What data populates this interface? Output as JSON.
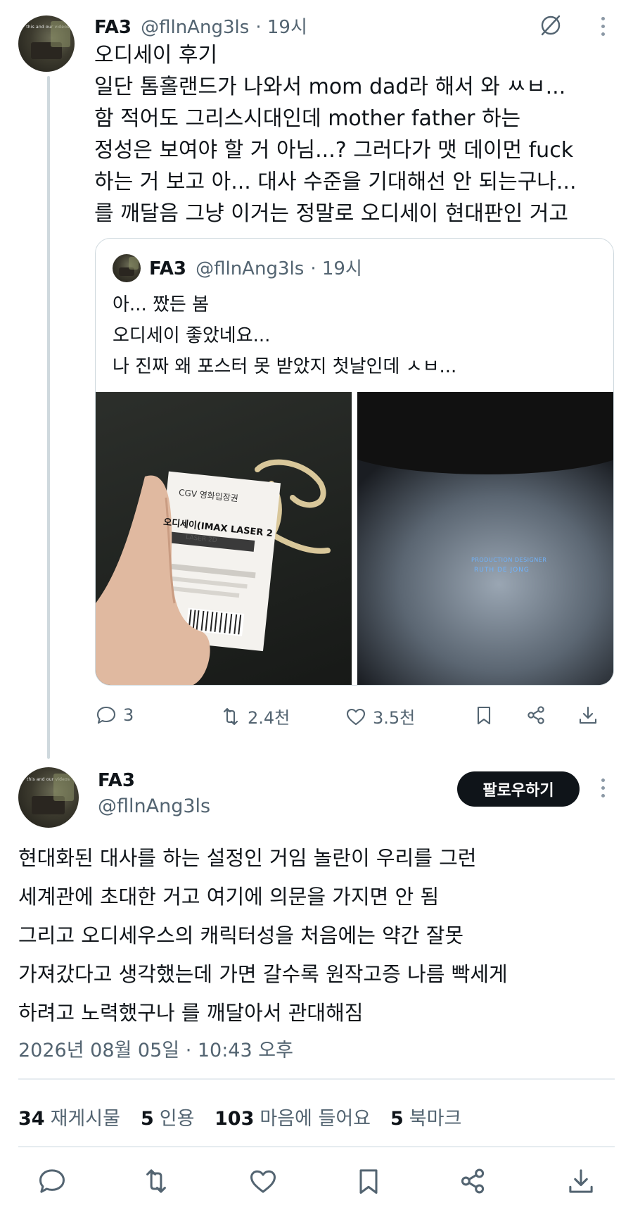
{
  "quoting_tweet": {
    "display_name": "FA3",
    "handle": "@fllnAng3ls",
    "time": "· 19시",
    "lines": [
      "오디세이 후기",
      "일단 톰홀랜드가 나와서 mom dad라 해서 와 ㅆㅂ...",
      "함 적어도 그리스시대인데 mother father 하는",
      "정성은 보여야 할 거 아님...? 그러다가 맷 데이먼 fuck",
      "하는 거 보고 아... 대사 수준을 기대해선 안 되는구나...",
      "를 깨달음 그냥 이거는 정말로 오디세이 현대판인 거고"
    ],
    "avatar_caption": "this and our videos",
    "actions": {
      "replies": "3",
      "retweets": "2.4천",
      "likes": "3.5천"
    }
  },
  "quoted_tweet": {
    "display_name": "FA3",
    "handle": "@fllnAng3ls",
    "time": "· 19시",
    "lines": [
      "아... 짰든 봄",
      "오디세이 좋았네요...",
      "나 진짜 왜 포스터 못 받았지 첫날인데 ㅅㅂ..."
    ],
    "ticket": {
      "header": "CGV 영화입장권",
      "title": "오디세이(IMAX LASER 2",
      "sub": "LASER 2D"
    },
    "credit": {
      "line1": "PRODUCTION DESIGNER",
      "line2": "RUTH DE JONG"
    }
  },
  "reply_tweet": {
    "display_name": "FA3",
    "handle": "@fllnAng3ls",
    "follow_label": "팔로우하기",
    "lines": [
      "현대화된 대사를 하는 설정인 거임 놀란이 우리를 그런",
      "세계관에 초대한 거고 여기에 의문을 가지면 안 됨",
      "그리고 오디세우스의 캐릭터성을 처음에는 약간 잘못",
      "가져갔다고 생각했는데 가면 갈수록 원작고증 나름 빡세게",
      "하려고 노력했구나 를 깨달아서 관대해짐"
    ],
    "timestamp": "2026년 08월 05일 · 10:43 오후",
    "stats": [
      {
        "count": "34",
        "label": "재게시물"
      },
      {
        "count": "5",
        "label": "인용"
      },
      {
        "count": "103",
        "label": "마음에 들어요"
      },
      {
        "count": "5",
        "label": "북마크"
      }
    ]
  },
  "colors": {
    "text": "#0f1419",
    "secondary": "#536471",
    "border": "#cfd9de",
    "button_bg": "#0f1419"
  },
  "icons": [
    "grok-icon",
    "more-icon",
    "reply-icon",
    "retweet-icon",
    "like-icon",
    "bookmark-icon",
    "share-icon",
    "download-icon"
  ]
}
